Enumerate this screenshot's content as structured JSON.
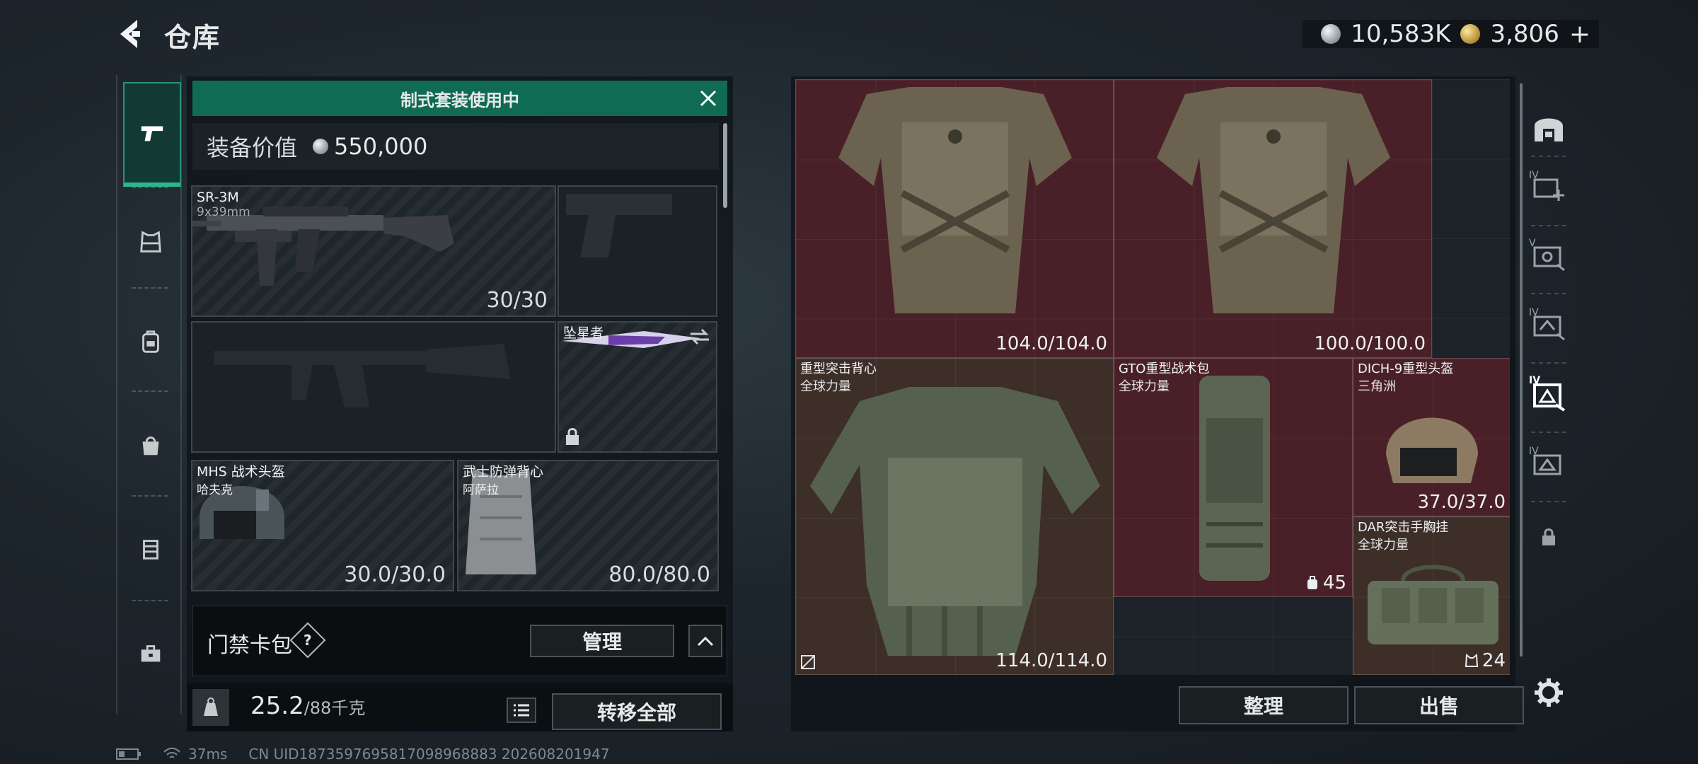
{
  "header": {
    "title": "仓库",
    "currency_silver": "10,583K",
    "currency_gold": "3,806",
    "add_label": "+"
  },
  "left_rail": {
    "items": [
      {
        "icon": "pistol-icon",
        "active": true
      },
      {
        "icon": "armor-vest-icon",
        "active": false
      },
      {
        "icon": "backpack-icon",
        "active": false
      },
      {
        "icon": "bag-icon",
        "active": false
      },
      {
        "icon": "container-icon",
        "active": false
      },
      {
        "icon": "toolbox-icon",
        "active": false
      }
    ]
  },
  "loadout": {
    "banner": "制式套装使用中",
    "equip_value_label": "装备价值",
    "equip_value": "550,000",
    "slots": {
      "primary": {
        "name": "SR-3M",
        "sub": "9x39mm",
        "value": "30/30"
      },
      "pistol": {
        "name": "",
        "value": ""
      },
      "secondary": {
        "name": "",
        "value": ""
      },
      "melee": {
        "name": "坠星者",
        "locked": true
      },
      "helmet": {
        "name": "MHS 战术头盔",
        "sub": "哈夫克",
        "value": "30.0/30.0"
      },
      "vest": {
        "name": "武士防弹背心",
        "sub": "阿萨拉",
        "value": "80.0/80.0"
      }
    },
    "card_pack_label": "门禁卡包",
    "card_help": "?",
    "manage_label": "管理",
    "weight_current": "25.2",
    "weight_max": "/88千克",
    "transfer_all_label": "转移全部"
  },
  "status": {
    "ping": "37ms",
    "uid": "CN UID1873597695817098968883 202608201947"
  },
  "stash": {
    "items": [
      {
        "id": "armor1",
        "name": "",
        "sub": "",
        "value": "104.0/104.0",
        "color": "red"
      },
      {
        "id": "armor2",
        "name": "",
        "sub": "",
        "value": "100.0/100.0",
        "color": "red"
      },
      {
        "id": "heavy-vest",
        "name": "重型突击背心",
        "sub": "全球力量",
        "value": "114.0/114.0",
        "color": "brown"
      },
      {
        "id": "gto-backpack",
        "name": "GTO重型战术包",
        "sub": "全球力量",
        "value": "45",
        "color": "red"
      },
      {
        "id": "dich-helmet",
        "name": "DICH-9重型头盔",
        "sub": "三角洲",
        "value": "37.0/37.0",
        "color": "red"
      },
      {
        "id": "dar-rig",
        "name": "DAR突击手胸挂",
        "sub": "全球力量",
        "value": "24",
        "color": "brown"
      }
    ],
    "sort_label": "整理",
    "sell_label": "出售"
  },
  "right_rail": {
    "tabs": [
      {
        "icon": "stash-home-icon",
        "label": ""
      },
      {
        "icon": "tab-iv-add-icon",
        "label": "IV"
      },
      {
        "icon": "tab-v-icon",
        "label": "V"
      },
      {
        "icon": "tab-iv-2-icon",
        "label": "IV"
      },
      {
        "icon": "tab-iv-3-icon",
        "label": "IV"
      },
      {
        "icon": "tab-iv-4-icon",
        "label": "IV"
      },
      {
        "icon": "lock-icon",
        "label": ""
      }
    ],
    "settings_icon": "gear-icon"
  },
  "colors": {
    "banner_green": "#0f6b52",
    "active_tab": "#2fb68f",
    "item_red": "#4a2028",
    "item_brown": "#3d2e28"
  }
}
